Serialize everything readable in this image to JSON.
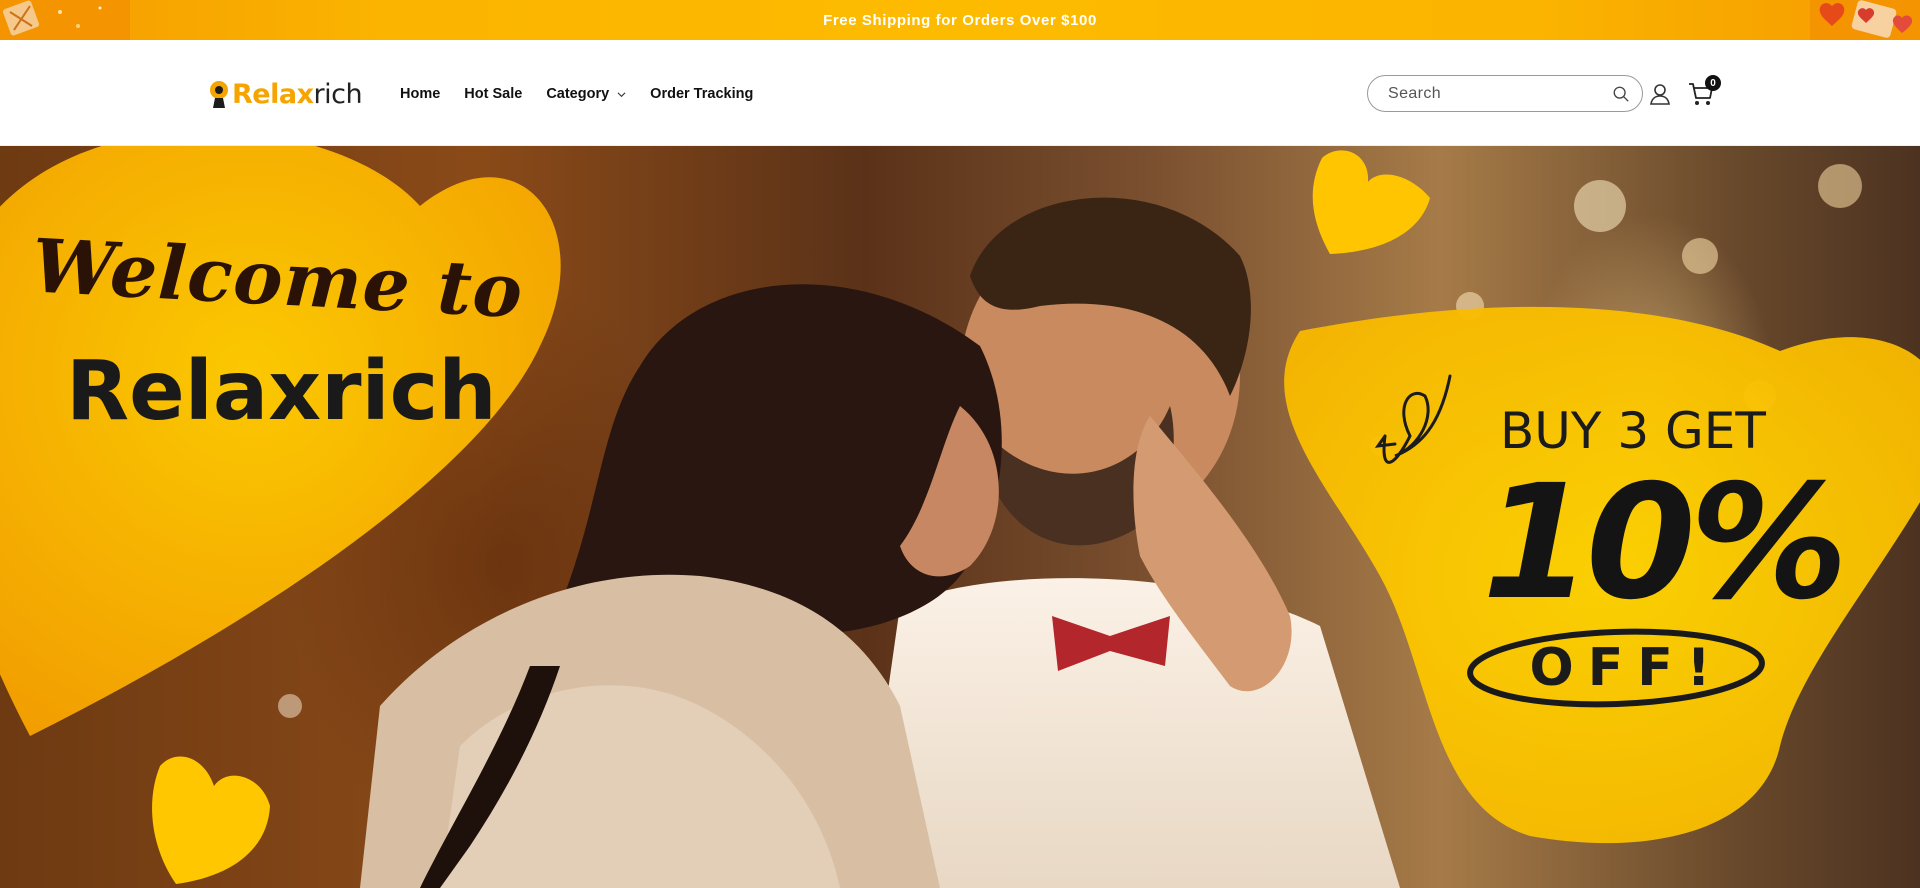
{
  "announcement": {
    "text": "Free Shipping for Orders Over $100"
  },
  "header": {
    "logo": {
      "bold": "Relax",
      "light": "rich"
    },
    "nav": [
      {
        "label": "Home"
      },
      {
        "label": "Hot Sale"
      },
      {
        "label": "Category",
        "has_dropdown": true
      },
      {
        "label": "Order Tracking"
      }
    ],
    "search": {
      "placeholder": "Search",
      "icon": "search-icon"
    },
    "account_icon": "user-icon",
    "cart": {
      "icon": "cart-icon",
      "count": "0"
    }
  },
  "hero": {
    "welcome": "Welcome to",
    "brand": "Relaxrich",
    "promo_line1": "BUY 3 GET",
    "promo_big": "10%",
    "promo_off": "OFF!"
  },
  "colors": {
    "accent": "#fdb400",
    "text": "#111111"
  }
}
